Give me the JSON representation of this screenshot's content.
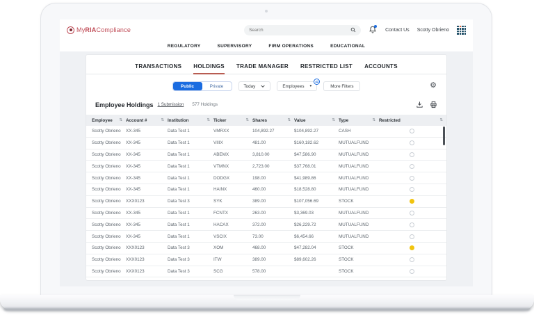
{
  "header": {
    "logo": {
      "my": "My",
      "ria": "RIA",
      "compliance": "Compliance"
    },
    "search_placeholder": "Search",
    "contact_us_label": "Contact Us",
    "user_name": "Scotty Obrieno"
  },
  "nav": {
    "items": [
      "REGULATORY",
      "SUPERVISORY",
      "FIRM OPERATIONS",
      "EDUCATIONAL"
    ]
  },
  "tabs": {
    "items": [
      {
        "label": "TRANSACTIONS",
        "active": false
      },
      {
        "label": "HOLDINGS",
        "active": true
      },
      {
        "label": "TRADE MANAGER",
        "active": false
      },
      {
        "label": "RESTRICTED LIST",
        "active": false
      },
      {
        "label": "ACCOUNTS",
        "active": false
      }
    ]
  },
  "filters": {
    "visibility_options": [
      {
        "label": "Public",
        "selected": true
      },
      {
        "label": "Private",
        "selected": false
      }
    ],
    "date_range_value": "Today",
    "employees_value": "Employees",
    "employees_badge": "41",
    "more_filters_label": "More Filters"
  },
  "section": {
    "title": "Employee Holdings",
    "submissions_link": "1 Submission",
    "holdings_count": "577 Holdings"
  },
  "table": {
    "columns": [
      "Employee",
      "Account #",
      "Institution",
      "Ticker",
      "Shares",
      "Value",
      "Type",
      "Restricted"
    ],
    "rows": [
      {
        "employee": "Scotty Obrieno",
        "account": "XX-345",
        "institution": "Data Test 1",
        "ticker": "VMRXX",
        "shares": "104,892.27",
        "value": "$104,892.27",
        "type": "CASH",
        "restricted": false
      },
      {
        "employee": "Scotty Obrieno",
        "account": "XX-345",
        "institution": "Data Test 1",
        "ticker": "VIIIX",
        "shares": "481.00",
        "value": "$160,182.62",
        "type": "MUTUALFUND",
        "restricted": false
      },
      {
        "employee": "Scotty Obrieno",
        "account": "XX-345",
        "institution": "Data Test 1",
        "ticker": "ABEMX",
        "shares": "3,810.00",
        "value": "$47,586.90",
        "type": "MUTUALFUND",
        "restricted": false
      },
      {
        "employee": "Scotty Obrieno",
        "account": "XX-345",
        "institution": "Data Test 1",
        "ticker": "VTMNX",
        "shares": "2,723.00",
        "value": "$37,768.01",
        "type": "MUTUALFUND",
        "restricted": false
      },
      {
        "employee": "Scotty Obrieno",
        "account": "XX-345",
        "institution": "Data Test 1",
        "ticker": "DODGX",
        "shares": "198.00",
        "value": "$41,989.86",
        "type": "MUTUALFUND",
        "restricted": false
      },
      {
        "employee": "Scotty Obrieno",
        "account": "XX-345",
        "institution": "Data Test 1",
        "ticker": "HAINX",
        "shares": "460.00",
        "value": "$18,528.80",
        "type": "MUTUALFUND",
        "restricted": false
      },
      {
        "employee": "Scotty Obrieno",
        "account": "XXX0123",
        "institution": "Data Test 3",
        "ticker": "SYK",
        "shares": "389.00",
        "value": "$107,056.69",
        "type": "STOCK",
        "restricted": true
      },
      {
        "employee": "Scotty Obrieno",
        "account": "XX-345",
        "institution": "Data Test 1",
        "ticker": "FCNTX",
        "shares": "263.00",
        "value": "$3,369.03",
        "type": "MUTUALFUND",
        "restricted": false
      },
      {
        "employee": "Scotty Obrieno",
        "account": "XX-345",
        "institution": "Data Test 1",
        "ticker": "HACAX",
        "shares": "372.00",
        "value": "$26,229.72",
        "type": "MUTUALFUND",
        "restricted": false
      },
      {
        "employee": "Scotty Obrieno",
        "account": "XX-345",
        "institution": "Data Test 1",
        "ticker": "VSCIX",
        "shares": "73.00",
        "value": "$6,454.66",
        "type": "MUTUALFUND",
        "restricted": false
      },
      {
        "employee": "Scotty Obrieno",
        "account": "XXX0123",
        "institution": "Data Test 3",
        "ticker": "XOM",
        "shares": "468.00",
        "value": "$47,282.04",
        "type": "STOCK",
        "restricted": true
      },
      {
        "employee": "Scotty Obrieno",
        "account": "XXX0123",
        "institution": "Data Test 3",
        "ticker": "ITW",
        "shares": "389.00",
        "value": "$89,602.26",
        "type": "STOCK",
        "restricted": false
      },
      {
        "employee": "Scotty Obrieno",
        "account": "XXX0123",
        "institution": "Data Test 3",
        "ticker": "SCG",
        "shares": "578.00",
        "value": "",
        "type": "STOCK",
        "restricted": false
      }
    ]
  },
  "icons": {
    "sort_glyph": "⇅",
    "gear_glyph": "⚙",
    "dropdown_caret_glyph": "▾"
  },
  "colors": {
    "brand_red": "#bf4a55",
    "accent_blue": "#1b6ce0",
    "tab_underline": "#b85c52",
    "restricted_yellow": "#f1c40f",
    "grid_icon_teal": "#1f4e66",
    "grid_icon_orange": "#e4532d"
  }
}
